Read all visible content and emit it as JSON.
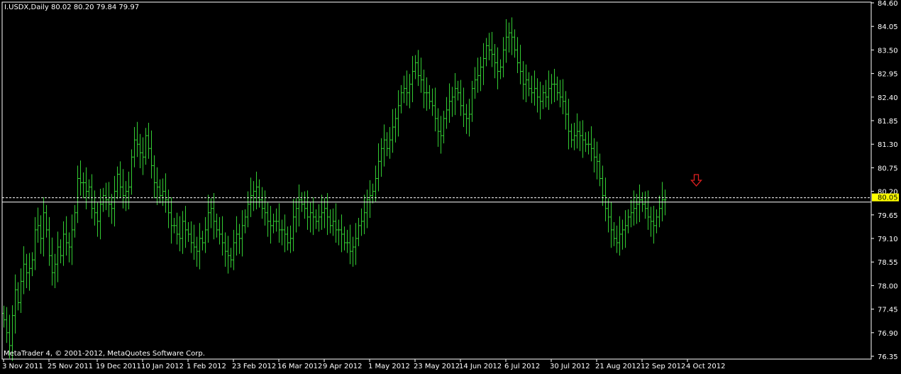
{
  "header": {
    "symbol_line": "I.USDX,Daily  80.02 80.20 79.84 79.97"
  },
  "footer": {
    "copyright": "MetaTrader 4, © 2001-2012, MetaQuotes Software Corp."
  },
  "price_tag": "80.05",
  "colors": {
    "background": "#000000",
    "bars": "#33cc33",
    "axis": "#ffffff",
    "arrow": "#e02020",
    "tag_bg": "#ffff00"
  },
  "chart_data": {
    "type": "ohlc_bar",
    "ylim": [
      76.35,
      84.6
    ],
    "y_ticks": [
      "84.60",
      "84.05",
      "83.50",
      "82.95",
      "82.40",
      "81.85",
      "81.30",
      "80.75",
      "80.20",
      "79.65",
      "79.10",
      "78.55",
      "78.00",
      "77.45",
      "76.90",
      "76.35"
    ],
    "y_tick_values": [
      84.6,
      84.05,
      83.5,
      82.95,
      82.4,
      81.85,
      81.3,
      80.75,
      80.2,
      79.65,
      79.1,
      78.55,
      78.0,
      77.45,
      76.9,
      76.35
    ],
    "x_ticks": [
      "3 Nov 2011",
      "25 Nov 2011",
      "19 Dec 2011",
      "10 Jan 2012",
      "1 Feb 2012",
      "23 Feb 2012",
      "16 Mar 2012",
      "9 Apr 2012",
      "1 May 2012",
      "23 May 2012",
      "14 Jun 2012",
      "6 Jul 2012",
      "30 Jul 2012",
      "21 Aug 2012",
      "12 Sep 2012",
      "4 Oct 2012"
    ],
    "x_tick_bar_index": [
      0,
      16,
      33,
      49,
      65,
      81,
      97,
      113,
      129,
      145,
      161,
      177,
      193,
      209,
      225,
      241
    ],
    "bid_level": 80.05,
    "close_line": 79.95,
    "signal_arrow": {
      "bar_index": 244,
      "direction": "down"
    },
    "closes": [
      77.2,
      76.9,
      76.6,
      77.3,
      77.9,
      77.6,
      78.1,
      78.5,
      78.3,
      78.4,
      78.6,
      79.3,
      79.4,
      79.1,
      79.7,
      79.3,
      78.7,
      78.3,
      78.5,
      78.9,
      78.7,
      79.2,
      79.0,
      78.9,
      79.3,
      79.7,
      80.5,
      80.4,
      80.4,
      80.2,
      80.3,
      79.8,
      79.7,
      79.5,
      79.9,
      80.1,
      80.0,
      79.9,
      79.8,
      80.2,
      80.6,
      80.3,
      80.1,
      80.2,
      80.3,
      81.0,
      81.4,
      81.3,
      81.1,
      81.0,
      81.5,
      81.2,
      80.8,
      80.4,
      80.3,
      80.1,
      80.2,
      80.0,
      79.7,
      79.4,
      79.4,
      79.2,
      79.1,
      79.5,
      79.3,
      79.2,
      79.0,
      78.9,
      78.8,
      79.1,
      79.0,
      79.3,
      79.7,
      79.8,
      79.5,
      79.3,
      79.2,
      79.0,
      78.8,
      78.7,
      78.6,
      79.0,
      79.2,
      79.1,
      79.4,
      79.6,
      79.9,
      80.1,
      80.2,
      80.3,
      80.0,
      79.8,
      79.7,
      79.5,
      79.4,
      79.5,
      79.5,
      79.3,
      79.3,
      79.2,
      79.0,
      79.1,
      79.6,
      79.8,
      80.0,
      79.9,
      79.8,
      79.6,
      79.7,
      79.6,
      79.5,
      79.6,
      79.7,
      79.8,
      79.6,
      79.4,
      79.5,
      79.3,
      79.3,
      79.2,
      79.0,
      79.0,
      78.8,
      78.9,
      79.1,
      79.4,
      79.5,
      79.7,
      80.0,
      80.1,
      80.2,
      80.5,
      80.9,
      81.2,
      81.4,
      81.2,
      81.4,
      81.7,
      81.9,
      82.2,
      82.5,
      82.6,
      82.5,
      82.7,
      83.0,
      83.2,
      82.9,
      82.8,
      82.5,
      82.5,
      82.3,
      82.2,
      81.9,
      81.6,
      81.5,
      81.9,
      82.1,
      82.3,
      82.4,
      82.6,
      82.5,
      82.2,
      82.0,
      81.9,
      82.0,
      82.6,
      82.8,
      82.9,
      83.1,
      83.3,
      83.6,
      83.5,
      83.4,
      83.2,
      83.0,
      83.1,
      83.5,
      83.8,
      83.9,
      83.8,
      83.5,
      83.2,
      83.0,
      82.7,
      82.8,
      82.6,
      82.5,
      82.6,
      82.4,
      82.3,
      82.5,
      82.4,
      82.6,
      82.7,
      82.7,
      82.5,
      82.4,
      82.3,
      82.0,
      81.6,
      81.4,
      81.5,
      81.6,
      81.5,
      81.4,
      81.3,
      81.3,
      81.2,
      81.0,
      80.9,
      80.5,
      80.1,
      79.8,
      79.6,
      79.3,
      79.1,
      79.0,
      79.2,
      79.3,
      79.4,
      79.6,
      79.7,
      79.8,
      79.9,
      80.0,
      79.9,
      79.8,
      79.6,
      79.5,
      79.4,
      79.6,
      79.8,
      80.0,
      80.0
    ]
  }
}
